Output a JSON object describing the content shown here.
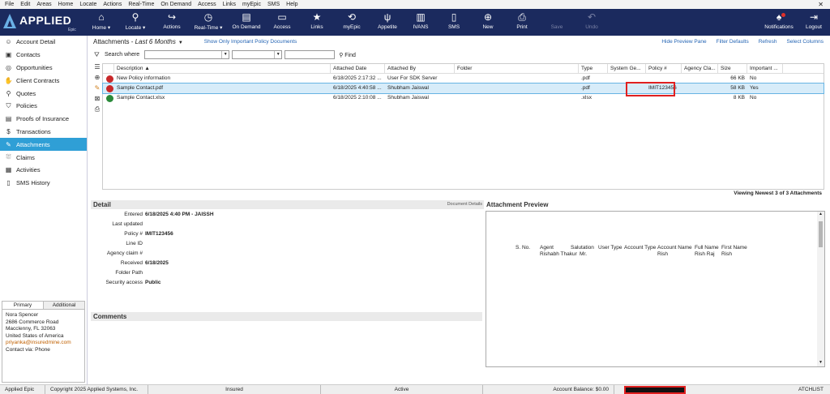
{
  "menubar": [
    "File",
    "Edit",
    "Areas",
    "Home",
    "Locate",
    "Actions",
    "Real-Time",
    "On Demand",
    "Access",
    "Links",
    "myEpic",
    "SMS",
    "Help"
  ],
  "logo": {
    "brand": "APPLIED",
    "sub": "Epic"
  },
  "toolbar": {
    "home": "Home",
    "locate": "Locate",
    "actions": "Actions",
    "realtime": "Real-Time",
    "ondemand": "On Demand",
    "access": "Access",
    "links": "Links",
    "myepic": "myEpic",
    "appetite": "Appetite",
    "ivans": "IVANS",
    "sms": "SMS",
    "new": "New",
    "print": "Print",
    "save": "Save",
    "undo": "Undo",
    "notifications": "Notifications",
    "logout": "Logout"
  },
  "sidebar": {
    "items": [
      {
        "label": "Account Detail",
        "icon": "person-icon"
      },
      {
        "label": "Contacts",
        "icon": "contacts-icon"
      },
      {
        "label": "Opportunities",
        "icon": "opportunities-icon"
      },
      {
        "label": "Client Contracts",
        "icon": "handshake-icon"
      },
      {
        "label": "Quotes",
        "icon": "quotes-icon"
      },
      {
        "label": "Policies",
        "icon": "shield-icon"
      },
      {
        "label": "Proofs of Insurance",
        "icon": "certificate-icon"
      },
      {
        "label": "Transactions",
        "icon": "dollar-icon"
      },
      {
        "label": "Attachments",
        "icon": "paperclip-icon"
      },
      {
        "label": "Claims",
        "icon": "claims-icon"
      },
      {
        "label": "Activities",
        "icon": "clipboard-icon"
      },
      {
        "label": "SMS History",
        "icon": "sms-icon"
      }
    ],
    "active_index": 8
  },
  "contact": {
    "tab_primary": "Primary",
    "tab_additional": "Additional",
    "name": "Nora Spencer",
    "address1": "2686 Commerce Road",
    "address2": "Macclenny, FL  32063",
    "country": "United States of America",
    "email": "priyanka@insuredmine.com",
    "contact_via": "Contact via: Phone"
  },
  "attachments": {
    "title": "Attachments",
    "period": "Last 6 Months",
    "important_link": "Show Only Important Policy Documents",
    "hide_preview": "Hide Preview Pane",
    "filter_defaults": "Filter Defaults",
    "refresh": "Refresh",
    "select_columns": "Select Columns",
    "search_label": "Search where",
    "find": "Find",
    "viewing": "Viewing Newest 3 of 3 Attachments",
    "columns": [
      "Description",
      "Attached Date",
      "Attached By",
      "Folder",
      "Type",
      "System Ge...",
      "Policy #",
      "Agency Cla...",
      "Size",
      "Important ..."
    ],
    "rows": [
      {
        "description": "New Policy information",
        "date": "6/18/2025 2:17:32 ...",
        "by": "User For SDK Server",
        "folder": "",
        "type": ".pdf",
        "system": "",
        "policy": "",
        "agency": "",
        "size": "66 KB",
        "important": "No",
        "icon": "pdf"
      },
      {
        "description": "Sample Contact.pdf",
        "date": "6/18/2025 4:40:58 ...",
        "by": "Shubham Jaiswal",
        "folder": "",
        "type": ".pdf",
        "system": "",
        "policy": "IMIT123456",
        "agency": "",
        "size": "58 KB",
        "important": "Yes",
        "icon": "pdf"
      },
      {
        "description": "Sample Contact.xlsx",
        "date": "6/18/2025 2:10:08 ...",
        "by": "Shubham Jaiswal",
        "folder": "",
        "type": ".xlsx",
        "system": "",
        "policy": "",
        "agency": "",
        "size": "8 KB",
        "important": "No",
        "icon": "xls"
      }
    ]
  },
  "detail": {
    "title": "Detail",
    "document_details": "Document Details",
    "entered_label": "Entered",
    "entered": "6/18/2025 4:40 PM - JAISSH",
    "last_updated_label": "Last updated",
    "last_updated": "",
    "policy_label": "Policy #",
    "policy": "IMIT123456",
    "line_label": "Line ID",
    "line": "",
    "claim_label": "Agency claim #",
    "claim": "",
    "received_label": "Received",
    "received": "6/18/2025",
    "folder_label": "Folder Path",
    "folder": "",
    "security_label": "Security access",
    "security": "Public"
  },
  "comments": {
    "title": "Comments"
  },
  "preview": {
    "title": "Attachment Preview",
    "headers": [
      "S. No.",
      "Agent",
      "Salutation",
      "User Type",
      "Account Type",
      "Account Name",
      "Full Name",
      "First Name"
    ],
    "row": [
      "",
      "Rishabh Thakur",
      "Mr.",
      "",
      "",
      "Rish",
      "Rish Raj",
      "Rish"
    ]
  },
  "statusbar": {
    "app": "Applied Epic",
    "copyright": "Copyright 2025 Applied Systems, Inc.",
    "insured": "Insured",
    "active": "Active",
    "balance": "Account Balance: $0.00",
    "code": "ATCHLIST"
  },
  "colors": {
    "toolbar": "#1b2a5e",
    "active_nav": "#2f9fd6",
    "highlight": "#e02020",
    "selected_row": "#d7ecf9"
  }
}
